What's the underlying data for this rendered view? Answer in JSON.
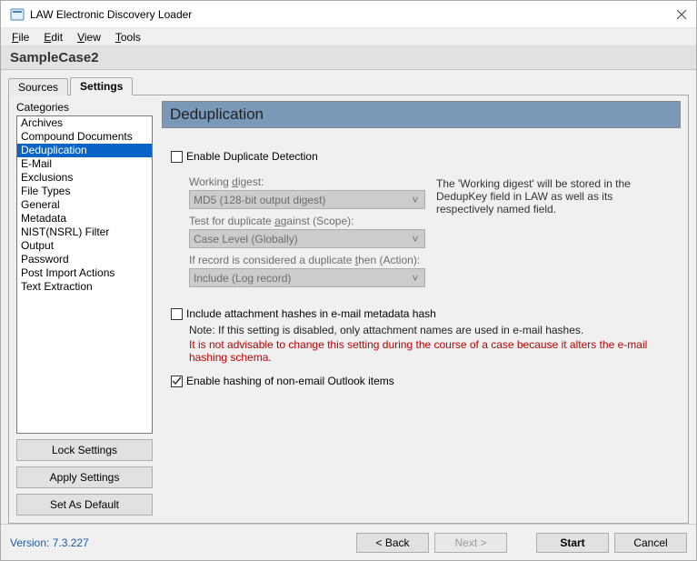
{
  "window": {
    "title": "LAW Electronic Discovery Loader"
  },
  "menu": {
    "file": "File",
    "edit": "Edit",
    "view": "View",
    "tools": "Tools"
  },
  "case_name": "SampleCase2",
  "tabs": {
    "sources": "Sources",
    "settings": "Settings"
  },
  "categories_label": "Categories",
  "categories": [
    "Archives",
    "Compound Documents",
    "Deduplication",
    "E-Mail",
    "Exclusions",
    "File Types",
    "General",
    "Metadata",
    "NIST(NSRL) Filter",
    "Output",
    "Password",
    "Post Import Actions",
    "Text Extraction"
  ],
  "selected_category_index": 2,
  "left_buttons": {
    "lock": "Lock Settings",
    "apply": "Apply Settings",
    "default": "Set As Default"
  },
  "panel": {
    "title": "Deduplication",
    "enable_dup": "Enable Duplicate Detection",
    "working_digest_label": "Working digest:",
    "working_digest_value": "MD5 (128-bit output digest)",
    "scope_label": "Test for duplicate against (Scope):",
    "scope_value": "Case Level (Globally)",
    "action_label": "If record is considered a duplicate then (Action):",
    "action_value": "Include (Log record)",
    "digest_hint": "The 'Working digest' will be stored in the DedupKey field in LAW as well as its respectively named field.",
    "include_attachment": "Include attachment hashes in e-mail metadata hash",
    "note": "Note: If this setting is disabled, only attachment names are used in e-mail hashes.",
    "warning": "It is not advisable to change this setting during the course of a case because it alters the e-mail hashing schema.",
    "enable_hashing": "Enable hashing of non-email Outlook items"
  },
  "footer": {
    "version": "Version: 7.3.227",
    "back": "< Back",
    "next": "Next >",
    "start": "Start",
    "cancel": "Cancel"
  }
}
